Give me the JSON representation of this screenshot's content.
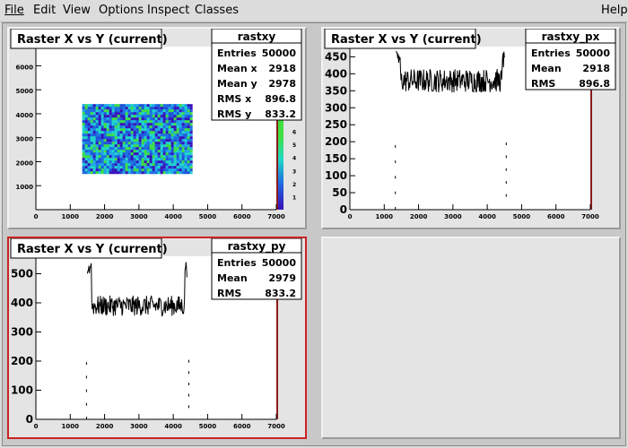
{
  "menu": {
    "file": "File",
    "edit": "Edit",
    "view": "View",
    "options": "Options",
    "inspect": "Inspect",
    "classes": "Classes",
    "help": "Help"
  },
  "colors": {
    "background": "#dcdcdc",
    "pad": "#e4e4e4",
    "frame": "#ffffff",
    "selected_border": "#cc2222",
    "axis": "#000000"
  },
  "pads": [
    {
      "title": "Raster X vs Y (current)",
      "stats": {
        "name": "rastxy",
        "rows": [
          {
            "label": "Entries",
            "value": "50000"
          },
          {
            "label": "Mean x",
            "value": "2918"
          },
          {
            "label": "Mean y",
            "value": "2978"
          },
          {
            "label": "RMS x",
            "value": "896.8"
          },
          {
            "label": "RMS y",
            "value": "833.2"
          }
        ]
      },
      "x_ticks": [
        "0",
        "1000",
        "2000",
        "3000",
        "4000",
        "5000",
        "6000",
        "7000"
      ],
      "y_ticks": [
        "1000",
        "2000",
        "3000",
        "4000",
        "5000",
        "6000"
      ],
      "palette_ticks": [
        "1",
        "2",
        "3",
        "4",
        "5",
        "6"
      ]
    },
    {
      "title": "Raster X vs Y (current)",
      "stats": {
        "name": "rastxy_px",
        "rows": [
          {
            "label": "Entries",
            "value": "50000"
          },
          {
            "label": "Mean",
            "value": "2918"
          },
          {
            "label": "RMS",
            "value": "896.8"
          }
        ]
      },
      "x_ticks": [
        "0",
        "1000",
        "2000",
        "3000",
        "4000",
        "5000",
        "6000",
        "7000"
      ],
      "y_ticks": [
        "0",
        "50",
        "100",
        "150",
        "200",
        "250",
        "300",
        "350",
        "400",
        "450"
      ]
    },
    {
      "title": "Raster X vs Y (current)",
      "stats": {
        "name": "rastxy_py",
        "rows": [
          {
            "label": "Entries",
            "value": "50000"
          },
          {
            "label": "Mean",
            "value": "2979"
          },
          {
            "label": "RMS",
            "value": "833.2"
          }
        ]
      },
      "x_ticks": [
        "0",
        "1000",
        "2000",
        "3000",
        "4000",
        "5000",
        "6000",
        "7000"
      ],
      "y_ticks": [
        "0",
        "100",
        "200",
        "300",
        "400",
        "500"
      ]
    }
  ],
  "chart_data": [
    {
      "type": "heatmap",
      "name": "rastxy",
      "x_range": [
        0,
        7000
      ],
      "y_range": [
        0,
        6800
      ],
      "filled_region": {
        "x": [
          1350,
          4500
        ],
        "y": [
          1500,
          4400
        ]
      },
      "z_range": [
        0,
        7
      ]
    },
    {
      "type": "line",
      "name": "rastxy_px",
      "x_range": [
        0,
        7000
      ],
      "y_range": [
        0,
        480
      ],
      "x_support": [
        1350,
        4500
      ],
      "plateau_level": 380,
      "peak": 470
    },
    {
      "type": "line",
      "name": "rastxy_py",
      "x_range": [
        0,
        7000
      ],
      "y_range": [
        0,
        560
      ],
      "x_support": [
        1500,
        4400
      ],
      "plateau_level": 390,
      "peak": 540
    }
  ]
}
